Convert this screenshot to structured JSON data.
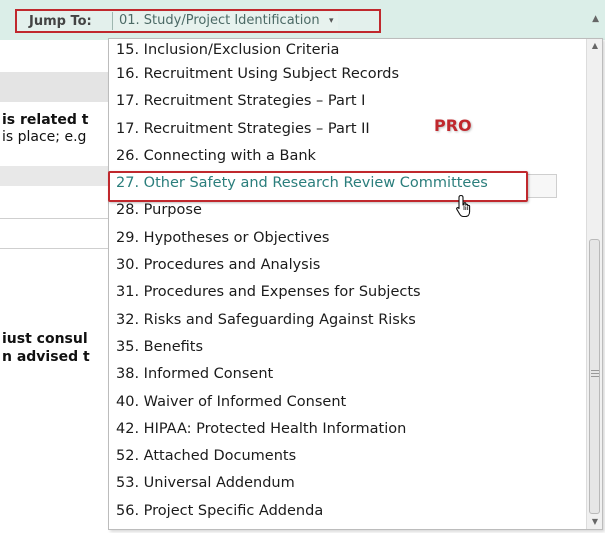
{
  "jump_to": {
    "label": "Jump To:",
    "selected": "01. Study/Project Identification",
    "caret": "▾"
  },
  "background_text": {
    "line1": "is related t",
    "line2": "is place; e.g",
    "line3": "iust consul",
    "line4": "n advised t"
  },
  "dropdown": {
    "items": [
      "15. Inclusion/Exclusion Criteria",
      "16. Recruitment Using Subject Records",
      "17. Recruitment Strategies – Part I",
      "17. Recruitment Strategies – Part II",
      "26. Connecting with a Bank",
      "27. Other Safety and Research Review Committees",
      "28. Purpose",
      "29. Hypotheses or Objectives",
      "30. Procedures and Analysis",
      "31. Procedures and Expenses for Subjects",
      "32. Risks and Safeguarding Against Risks",
      "35. Benefits",
      "38. Informed Consent",
      "40. Waiver of Informed Consent",
      "42. HIPAA: Protected Health Information",
      "52. Attached Documents",
      "53. Universal Addendum",
      "56.  Project Specific Addenda"
    ],
    "highlighted_index": 5
  },
  "annotation": {
    "pro_label": "PRO",
    "color": "#c0282d"
  },
  "icons": {
    "cursor": "hand-pointer-icon",
    "scroll_up": "scroll-up-arrow-icon",
    "scroll_down": "scroll-down-arrow-icon"
  }
}
